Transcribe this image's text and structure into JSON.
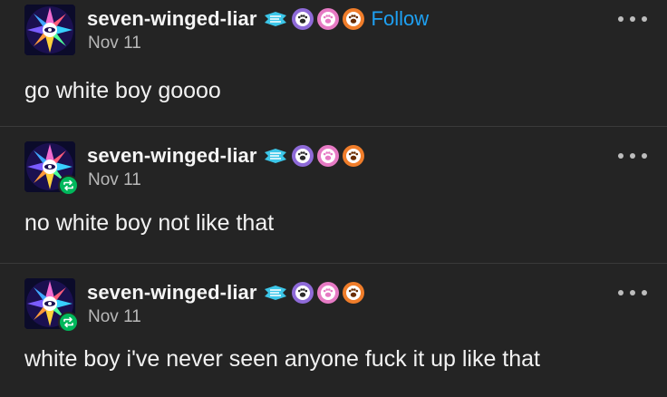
{
  "colors": {
    "background": "#242424",
    "divider": "#3a3a3a",
    "follow": "#1ea0f2",
    "reblog_badge": "#00b85c",
    "badge_purple": "#8e6ad8",
    "badge_pink": "#e67ac4",
    "badge_orange": "#f07d2a",
    "badge_cyan": "#3cc6e8"
  },
  "posts": [
    {
      "username": "seven-winged-liar",
      "badges": [
        "cyan-wing-badge-icon",
        "purple-paw-badge-icon",
        "pink-paw-badge-icon",
        "orange-paw-badge-icon"
      ],
      "follow_label": "Follow",
      "date": "Nov 11",
      "reblog_icon": false,
      "menu_icon": "more-dots-icon",
      "text": "go white boy goooo"
    },
    {
      "username": "seven-winged-liar",
      "badges": [
        "cyan-wing-badge-icon",
        "purple-paw-badge-icon",
        "pink-paw-badge-icon",
        "orange-paw-badge-icon"
      ],
      "date": "Nov 11",
      "reblog_icon": true,
      "menu_icon": "more-dots-icon",
      "text": "no white boy not like that"
    },
    {
      "username": "seven-winged-liar",
      "badges": [
        "cyan-wing-badge-icon",
        "purple-paw-badge-icon",
        "pink-paw-badge-icon",
        "orange-paw-badge-icon"
      ],
      "date": "Nov 11",
      "reblog_icon": true,
      "menu_icon": "more-dots-icon",
      "text": "white boy i've never seen anyone fuck it up like that"
    }
  ]
}
